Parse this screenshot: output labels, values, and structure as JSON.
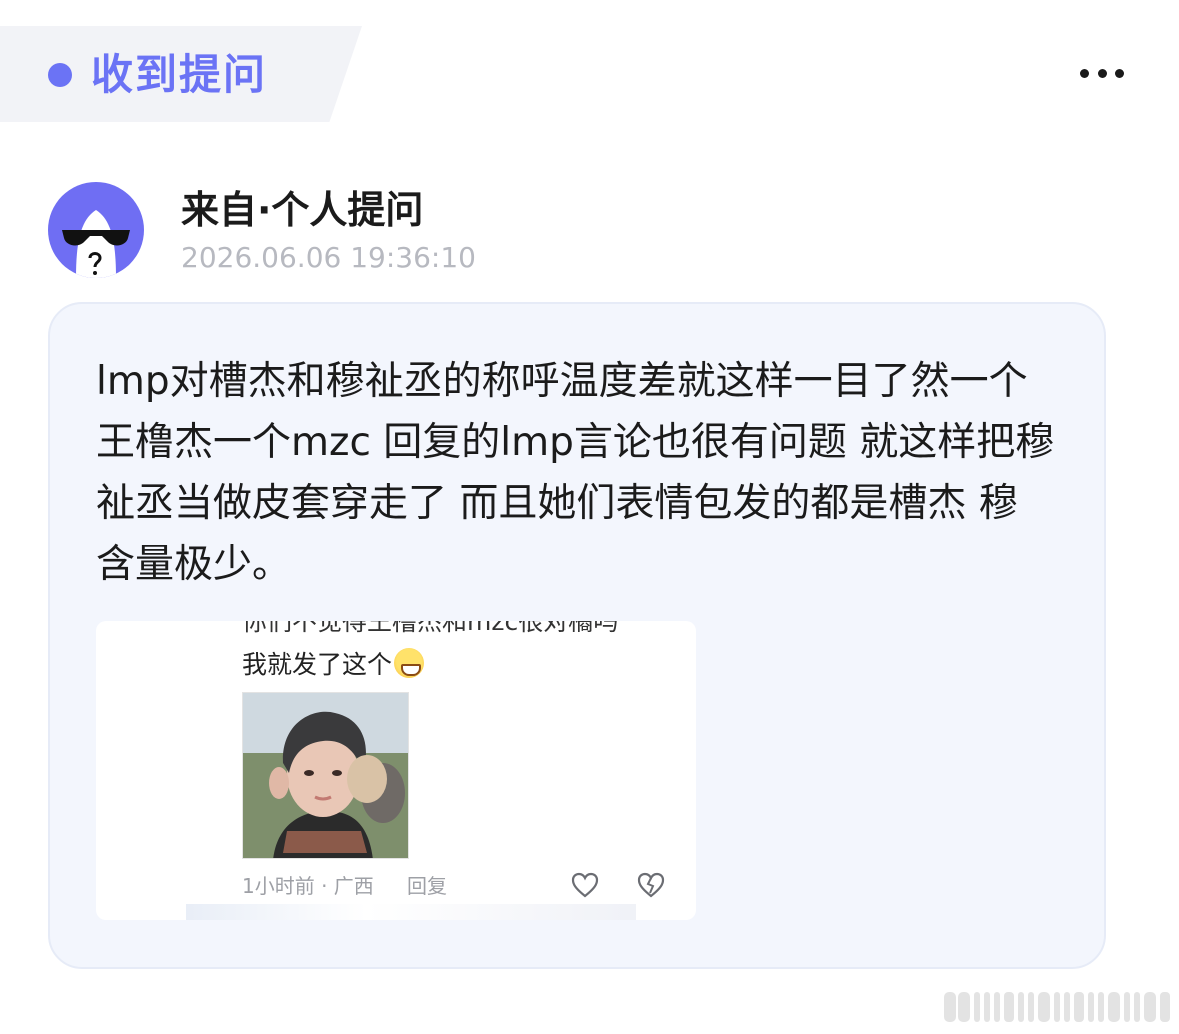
{
  "header": {
    "title": "收到提问",
    "more_icon": "more-horizontal-icon",
    "accent_color": "#6b73f5"
  },
  "sender": {
    "name": "来自·个人提问",
    "time": "2026.06.06 19:36:10",
    "avatar_icon": "anonymous-sunglasses-avatar-icon"
  },
  "question": {
    "text": "lmp对槽杰和穆祉丞的称呼温度差就这样一目了然一个王橹杰一个mzc 回复的lmp言论也很有问题 就这样把穆祉丞当做皮套穿走了 而且她们表情包发的都是槽杰 穆含量极少。",
    "attachment": {
      "cut_line": "你们不觉得王橹杰和mzc很对橘吗",
      "comment": "我就发了这个",
      "emoji_icon": "grin-sweat-emoji-icon",
      "meta": "1小时前 · 广西",
      "reply_label": "回复",
      "like_icon": "heart-outline-icon",
      "dislike_icon": "broken-heart-icon"
    }
  }
}
